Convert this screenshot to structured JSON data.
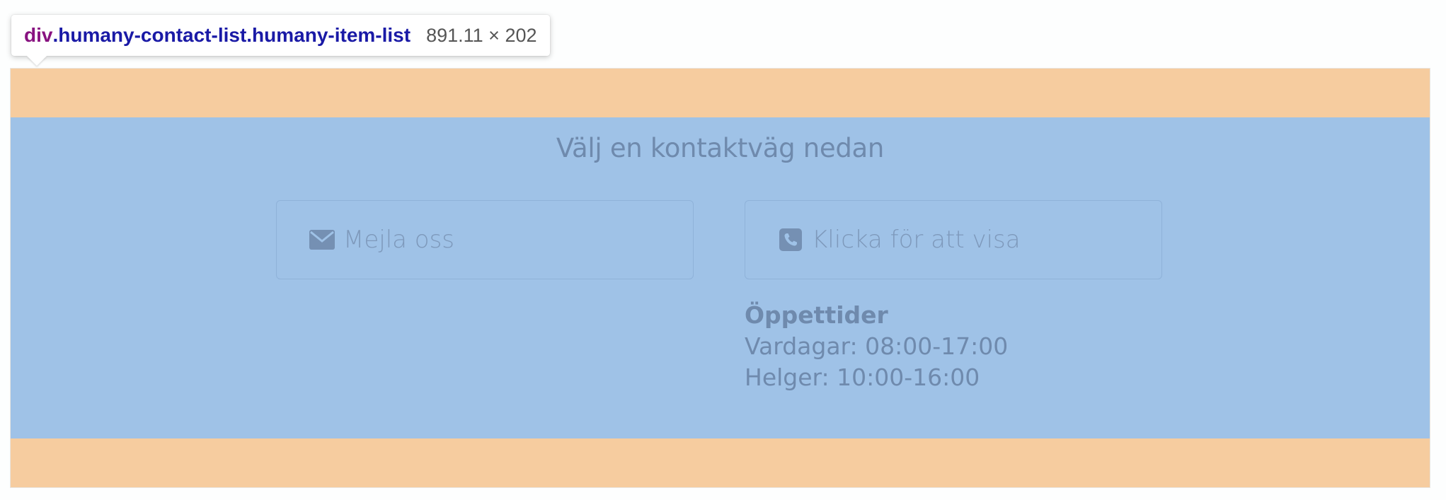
{
  "inspector": {
    "tag": "div",
    "classes": ".humany-contact-list.humany-item-list",
    "size": "891.11 × 202"
  },
  "contact": {
    "heading": "Välj en kontaktväg nedan",
    "options": [
      {
        "label": "Mejla oss",
        "icon": "envelope-icon"
      },
      {
        "label": "Klicka för att visa",
        "icon": "phone-icon"
      }
    ],
    "hours": {
      "title": "Öppettider",
      "lines": [
        "Vardagar: 08:00-17:00",
        "Helger: 10:00-16:00"
      ]
    }
  },
  "colors": {
    "margin_highlight": "#f6cc9f",
    "content_highlight": "#9fc2e7",
    "text": "#6f8aad",
    "tag": "#881280",
    "classes": "#1a1aa6"
  }
}
